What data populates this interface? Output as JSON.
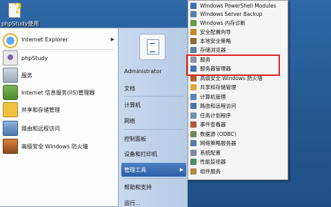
{
  "desktop": {
    "icon_label": "phpStudy使用"
  },
  "start_left": {
    "items": [
      {
        "label": "Internet Explorer",
        "icon": "internet-explorer-icon",
        "has_arrow": true
      },
      {
        "label": "phpStudy",
        "icon": "phpstudy-icon",
        "has_arrow": false
      },
      {
        "label": "服务",
        "icon": "services-icon",
        "has_arrow": false
      },
      {
        "label": "Internet 信息服务(IIS)管理器",
        "icon": "iis-manager-icon",
        "has_arrow": false
      },
      {
        "label": "共享和存储管理",
        "icon": "share-storage-icon",
        "has_arrow": false
      },
      {
        "label": "路由和远程访问",
        "icon": "routing-remote-icon",
        "has_arrow": false
      },
      {
        "label": "高级安全 Windows 防火墙",
        "icon": "firewall-icon",
        "has_arrow": false
      }
    ]
  },
  "start_right": {
    "items": [
      {
        "label": "Administrator",
        "arrow": false
      },
      {
        "label": "文档",
        "arrow": false
      },
      {
        "label": "计算机",
        "arrow": false
      },
      {
        "label": "网络",
        "arrow": false
      },
      {
        "label": "控制面板",
        "arrow": false
      },
      {
        "label": "设备和打印机",
        "arrow": false
      },
      {
        "label": "管理工具",
        "arrow": true
      },
      {
        "label": "帮助和支持",
        "arrow": false
      },
      {
        "label": "运行...",
        "arrow": false
      }
    ]
  },
  "submenu": {
    "items": [
      {
        "label": "Windows PowerShell Modules",
        "color": "#3b6fb6"
      },
      {
        "label": "Windows Server Backup",
        "color": "#5a7fa8"
      },
      {
        "label": "Windows 内存诊断",
        "color": "#6a9a4a"
      },
      {
        "label": "安全配置向导",
        "color": "#c08a2a"
      },
      {
        "label": "本地安全策略",
        "color": "#8a6a3a"
      },
      {
        "label": "存储浏览器",
        "color": "#5b7ea6"
      },
      {
        "label": "服务",
        "color": "#8a96a6"
      },
      {
        "label": "服务器管理器",
        "color": "#4a70a8"
      },
      {
        "label": "高级安全 Windows 防火墙",
        "color": "#b0602a"
      },
      {
        "label": "共享和存储管理",
        "color": "#d8a83a"
      },
      {
        "label": "计算机管理",
        "color": "#5a86b8"
      },
      {
        "label": "路由和远程访问",
        "color": "#4a78ad"
      },
      {
        "label": "任务计划程序",
        "color": "#6b8fb5"
      },
      {
        "label": "事件查看器",
        "color": "#a85a3a"
      },
      {
        "label": "数据源 (ODBC)",
        "color": "#6a8a5a"
      },
      {
        "label": "网络策略服务器",
        "color": "#5a7aa0"
      },
      {
        "label": "系统配置",
        "color": "#7a8aa0"
      },
      {
        "label": "性能监视器",
        "color": "#4a8a6a"
      },
      {
        "label": "组件服务",
        "color": "#b08a3a"
      }
    ]
  },
  "colors": {
    "desktop": "#2a5c97",
    "menu_highlight": "#2e5fa6",
    "annotation_box": "#e02020"
  }
}
